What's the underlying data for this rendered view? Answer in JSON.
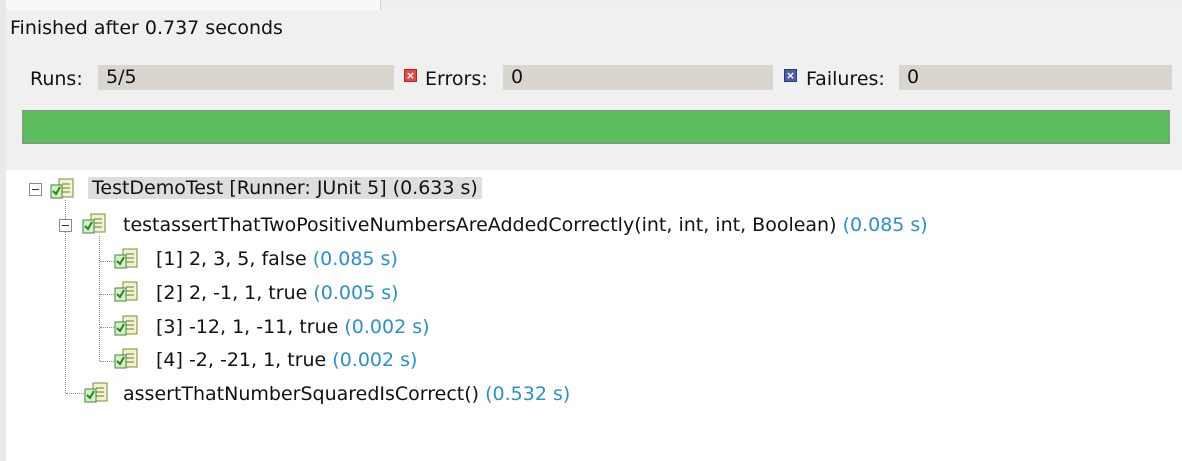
{
  "status": {
    "finished": "Finished after 0.737 seconds"
  },
  "counters": {
    "runs_label": "Runs:",
    "runs_value": "5/5",
    "errors_label": "Errors:",
    "errors_value": "0",
    "failures_label": "Failures:",
    "failures_value": "0"
  },
  "progress": {
    "fraction": 1.0,
    "color": "#5cbd5c"
  },
  "tree": {
    "root": {
      "label": "TestDemoTest [Runner: JUnit 5] (0.633 s)"
    },
    "test1": {
      "label": "testassertThatTwoPositiveNumbersAreAddedCorrectly(int, int, int, Boolean)",
      "time": "(0.085 s)",
      "cases": [
        {
          "label": "[1] 2, 3, 5, false",
          "time": "(0.085 s)"
        },
        {
          "label": "[2] 2, -1, 1, true",
          "time": "(0.005 s)"
        },
        {
          "label": "[3] -12, 1, -11, true",
          "time": "(0.002 s)"
        },
        {
          "label": "[4] -2, -21, 1, true",
          "time": "(0.002 s)"
        }
      ]
    },
    "test2": {
      "label": "assertThatNumberSquaredIsCorrect()",
      "time": "(0.532 s)"
    }
  },
  "icons": {
    "node": "test-pass-icon",
    "errors": "error-icon",
    "failures": "failure-icon",
    "toggle": "collapse-icon"
  }
}
